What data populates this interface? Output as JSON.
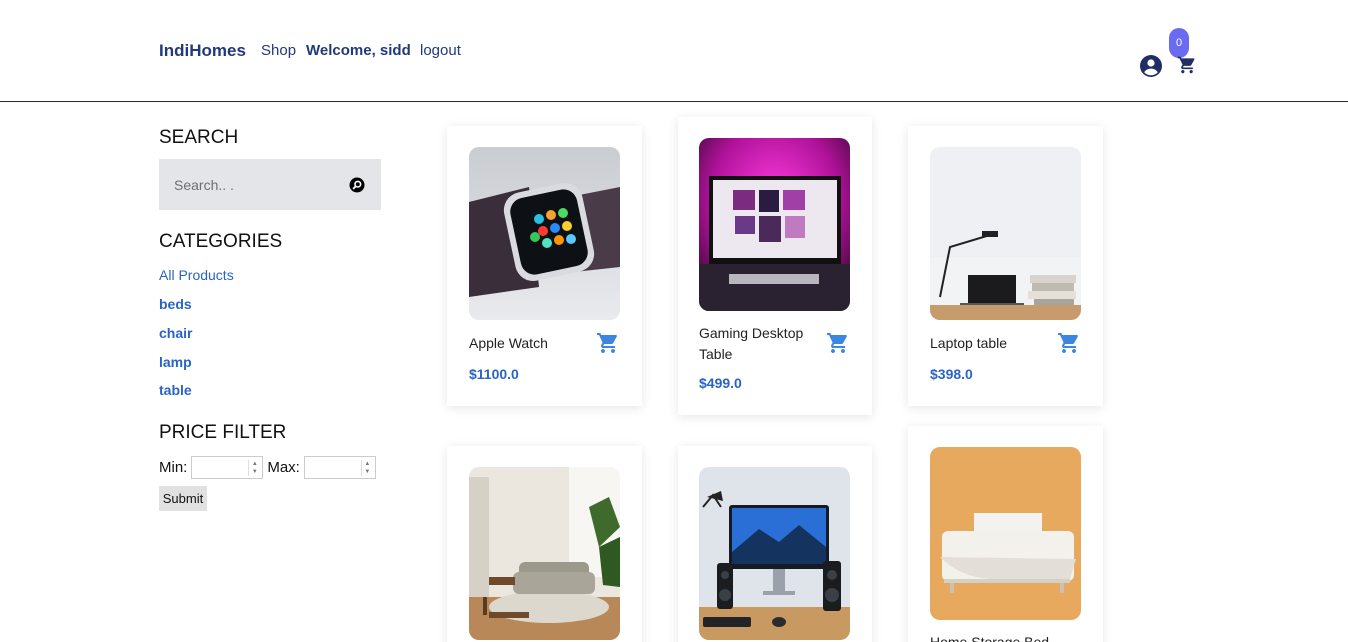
{
  "header": {
    "brand": "IndiHomes",
    "nav": {
      "shop": "Shop",
      "welcome": "Welcome, sidd",
      "logout": "logout"
    },
    "cart_count": "0"
  },
  "sidebar": {
    "search_title": "SEARCH",
    "search_placeholder": "Search.. .",
    "categories_title": "CATEGORIES",
    "categories": [
      "All Products",
      "beds",
      "chair",
      "lamp",
      "table"
    ],
    "price_title": "PRICE FILTER",
    "min_label": "Min:",
    "max_label": "Max:",
    "submit_label": "Submit"
  },
  "products": [
    {
      "name": "Apple Watch",
      "price": "$1100.0",
      "image": "apple-watch-image"
    },
    {
      "name": "Gaming Desktop Table",
      "price": "$499.0",
      "image": "gaming-desktop-image"
    },
    {
      "name": "Laptop table",
      "price": "$398.0",
      "image": "laptop-table-image"
    },
    {
      "name": "",
      "price": "",
      "image": "living-room-chair-image"
    },
    {
      "name": "",
      "price": "",
      "image": "desktop-computer-image"
    },
    {
      "name": "Home Storage Bed",
      "price": "",
      "image": "storage-bed-image"
    }
  ],
  "colors": {
    "accent": "#2a63c8",
    "brand": "#223a7a",
    "badge": "#6a6bf0"
  }
}
